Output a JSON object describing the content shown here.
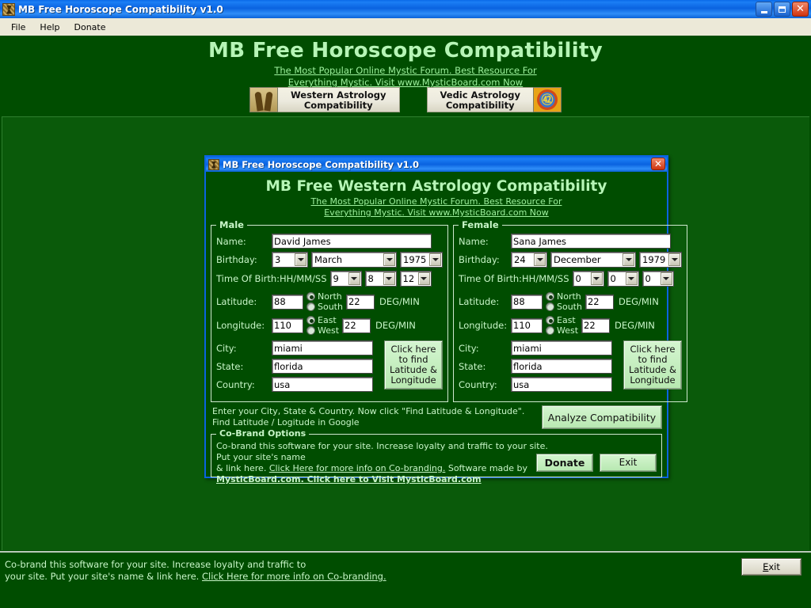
{
  "window": {
    "title": "MB Free Horoscope Compatibility v1.0",
    "icon": "app-icon",
    "buttons": {
      "minimize": "_",
      "maximize": "❐",
      "close": "✕"
    }
  },
  "menubar": {
    "items": [
      "File",
      "Help",
      "Donate"
    ]
  },
  "header": {
    "heading": "MB Free Horoscope Compatibility",
    "subtitle_line1": "The Most Popular Online Mystic Forum. Best Resource For ",
    "subtitle_line2": "Everything Mystic. Visit www.MysticBoard.com Now"
  },
  "tabs": [
    {
      "id": "western",
      "line1": "Western Astrology",
      "line2": "Compatibility",
      "icon": "couple-icon",
      "selected": true
    },
    {
      "id": "vedic",
      "line1": "Vedic Astrology",
      "line2": "Compatibility",
      "icon": "swastika-disc-icon",
      "selected": false
    }
  ],
  "dialog": {
    "title": "MB Free Horoscope Compatibility v1.0",
    "close_label": "✕",
    "heading": "MB Free Western Astrology Compatibility",
    "subtitle_line1": "The Most Popular Online Mystic Forum. Best Resource For ",
    "subtitle_line2": "Everything Mystic. Visit www.MysticBoard.com Now",
    "male": {
      "legend": "Male",
      "labels": {
        "name": "Name:",
        "birthday": "Birthday:",
        "time_of_birth": "Time Of Birth:HH/MM/SS",
        "latitude": "Latitude:",
        "longitude": "Longitude:",
        "city": "City:",
        "state": "State:",
        "country": "Country:",
        "deg_min": "DEG/MIN"
      },
      "name": "David James",
      "birth_day": "3",
      "birth_month": "March",
      "birth_year": "1975",
      "time_hh": "9",
      "time_mm": "8",
      "time_ss": "12",
      "latitude_deg": "88",
      "latitude_min": "22",
      "longitude_deg": "110",
      "longitude_min": "22",
      "lat_north_label": "North",
      "lat_south_label": "South",
      "lat_selected": "North",
      "lon_east_label": "East",
      "lon_west_label": "West",
      "lon_selected": "East",
      "city": "miami",
      "state": "florida",
      "country": "usa",
      "find_button": "Click here to find Latitude & Longitude"
    },
    "female": {
      "legend": "Female",
      "labels": {
        "name": "Name:",
        "birthday": "Birthday:",
        "time_of_birth": "Time Of Birth:HH/MM/SS",
        "latitude": "Latitude:",
        "longitude": "Longitude:",
        "city": "City:",
        "state": "State:",
        "country": "Country:",
        "deg_min": "DEG/MIN"
      },
      "name": "Sana James",
      "birth_day": "24",
      "birth_month": "December",
      "birth_year": "1979",
      "time_hh": "0",
      "time_mm": "0",
      "time_ss": "0",
      "latitude_deg": "88",
      "latitude_min": "22",
      "longitude_deg": "110",
      "longitude_min": "22",
      "lat_north_label": "North",
      "lat_south_label": "South",
      "lat_selected": "North",
      "lon_east_label": "East",
      "lon_west_label": "West",
      "lon_selected": "East",
      "city": "miami",
      "state": "florida",
      "country": "usa",
      "find_button": "Click here to find Latitude & Longitude"
    },
    "note_line1": "Enter your City, State & Country. Now click \"Find Latitude & Longitude\".",
    "note_line2": "Find Latitude / Logitude in Google",
    "analyze_button": "Analyze Compatibility",
    "cobrand": {
      "legend": "Co-Brand Options",
      "line1": "Co-brand this software for your site.  Increase loyalty and traffic to your site. Put your site's name",
      "line2_prefix": "&  link here. ",
      "line2_link": "Click Here for more info on Co-branding.",
      "line2_suffix": " Software made by",
      "line3": "MysticBoard.com. Click here to Visit MysticBoard.com",
      "donate_button": "Donate",
      "exit_button": "Exit"
    }
  },
  "statusbar": {
    "line1": "Co-brand this software for your site.  Increase loyalty and traffic to",
    "line2_prefix": "your site. Put your site's name &  link here. ",
    "line2_link": "Click Here for more info on Co-branding.",
    "exit_button": "Exit",
    "exit_accel": "E",
    "exit_rest": "xit"
  },
  "colors": {
    "window_bg": "#004d00",
    "client_bg": "#0a5a0a",
    "title_blue": "#0a63e0",
    "heading_green": "#b6f5b6",
    "text_green": "#c8f5c8",
    "button_green": "#cdf0c8"
  }
}
